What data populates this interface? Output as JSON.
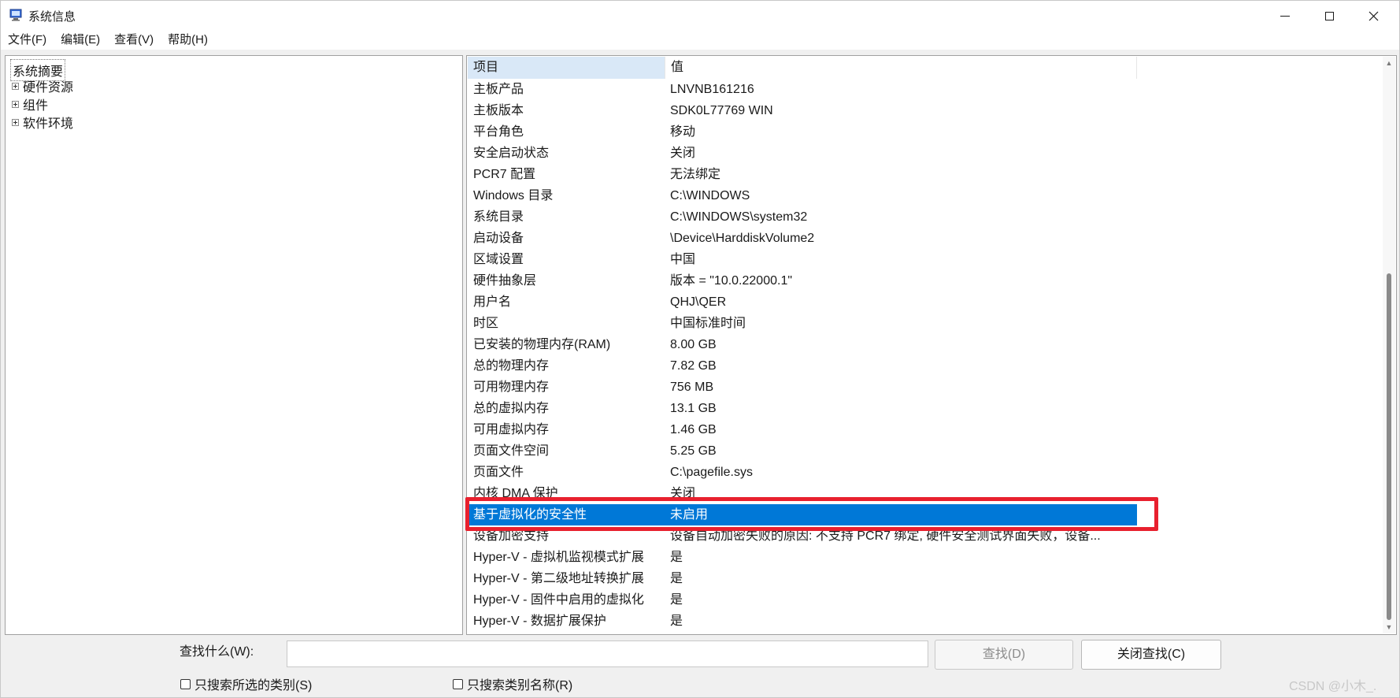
{
  "window": {
    "title": "系统信息",
    "icon": "system-info-icon"
  },
  "menu": [
    {
      "label": "文件(F)"
    },
    {
      "label": "编辑(E)"
    },
    {
      "label": "查看(V)"
    },
    {
      "label": "帮助(H)"
    }
  ],
  "tree": {
    "root": "系统摘要",
    "nodes": [
      {
        "label": "硬件资源"
      },
      {
        "label": "组件"
      },
      {
        "label": "软件环境"
      }
    ]
  },
  "table": {
    "columns": [
      "项目",
      "值"
    ],
    "rows": [
      {
        "k": "主板产品",
        "v": "LNVNB161216"
      },
      {
        "k": "主板版本",
        "v": "SDK0L77769 WIN"
      },
      {
        "k": "平台角色",
        "v": "移动"
      },
      {
        "k": "安全启动状态",
        "v": "关闭"
      },
      {
        "k": "PCR7 配置",
        "v": "无法绑定"
      },
      {
        "k": "Windows 目录",
        "v": "C:\\WINDOWS"
      },
      {
        "k": "系统目录",
        "v": "C:\\WINDOWS\\system32"
      },
      {
        "k": "启动设备",
        "v": "\\Device\\HarddiskVolume2"
      },
      {
        "k": "区域设置",
        "v": "中国"
      },
      {
        "k": "硬件抽象层",
        "v": "版本 = \"10.0.22000.1\""
      },
      {
        "k": "用户名",
        "v": "QHJ\\QER"
      },
      {
        "k": "时区",
        "v": "中国标准时间"
      },
      {
        "k": "已安装的物理内存(RAM)",
        "v": "8.00 GB"
      },
      {
        "k": "总的物理内存",
        "v": "7.82 GB"
      },
      {
        "k": "可用物理内存",
        "v": "756 MB"
      },
      {
        "k": "总的虚拟内存",
        "v": "13.1 GB"
      },
      {
        "k": "可用虚拟内存",
        "v": "1.46 GB"
      },
      {
        "k": "页面文件空间",
        "v": "5.25 GB"
      },
      {
        "k": "页面文件",
        "v": "C:\\pagefile.sys"
      },
      {
        "k": "内核 DMA 保护",
        "v": "关闭"
      },
      {
        "k": "基于虚拟化的安全性",
        "v": "未启用",
        "selected": true
      },
      {
        "k": "设备加密支持",
        "v": "设备自动加密失败的原因: 不支持 PCR7 绑定, 硬件安全测试界面失败，设备..."
      },
      {
        "k": "Hyper-V - 虚拟机监视模式扩展",
        "v": "是"
      },
      {
        "k": "Hyper-V - 第二级地址转换扩展",
        "v": "是"
      },
      {
        "k": "Hyper-V - 固件中启用的虚拟化",
        "v": "是"
      },
      {
        "k": "Hyper-V - 数据扩展保护",
        "v": "是"
      }
    ]
  },
  "find": {
    "label": "查找什么(W):",
    "value": "",
    "find_button": "查找(D)",
    "close_button": "关闭查找(C)",
    "check_selected_only": "只搜索所选的类别(S)",
    "check_category_names": "只搜索类别名称(R)"
  },
  "watermark": "CSDN @小木_.",
  "colors": {
    "selection": "#0078d7",
    "highlight_border": "#e8202e",
    "header_bg": "#d9e8f7"
  }
}
